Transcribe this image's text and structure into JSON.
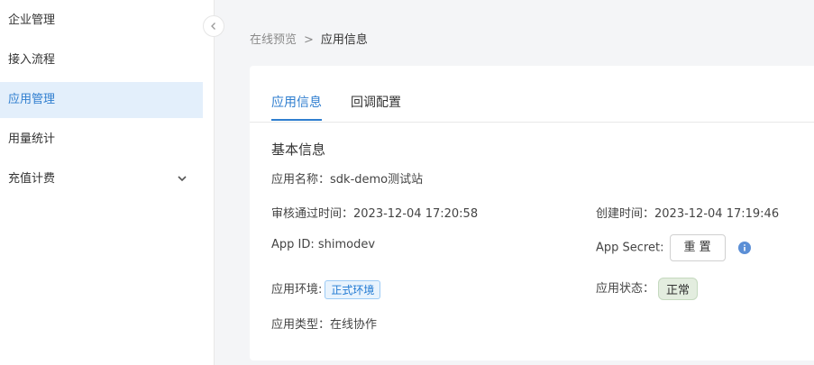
{
  "sidebar": {
    "items": [
      {
        "label": "企业管理"
      },
      {
        "label": "接入流程"
      },
      {
        "label": "应用管理"
      },
      {
        "label": "用量统计"
      },
      {
        "label": "充值计费"
      }
    ]
  },
  "breadcrumb": {
    "parent": "在线预览",
    "separator": ">",
    "current": "应用信息"
  },
  "tabs": [
    {
      "label": "应用信息"
    },
    {
      "label": "回调配置"
    }
  ],
  "section": {
    "title": "基本信息"
  },
  "fields": {
    "app_name": {
      "label": "应用名称：",
      "value": "sdk-demo测试站"
    },
    "review_time": {
      "label": "审核通过时间：",
      "value": "2023-12-04 17:20:58"
    },
    "create_time": {
      "label": "创建时间：",
      "value": "2023-12-04 17:19:46"
    },
    "app_id": {
      "label": "App ID: ",
      "value": "shimodev"
    },
    "app_secret": {
      "label": "App Secret:",
      "button": "重 置"
    },
    "env": {
      "label": "应用环境:",
      "value": "正式环境"
    },
    "status": {
      "label": "应用状态：",
      "value": "正常"
    },
    "type": {
      "label": "应用类型：",
      "value": "在线协作"
    }
  },
  "colors": {
    "accent": "#2f7ecf",
    "active_bg": "#e3effb",
    "info_icon": "#5b8fd6"
  },
  "icons": {
    "collapse": "chevron-left-icon",
    "expand": "chevron-down-icon",
    "info": "info-icon"
  }
}
